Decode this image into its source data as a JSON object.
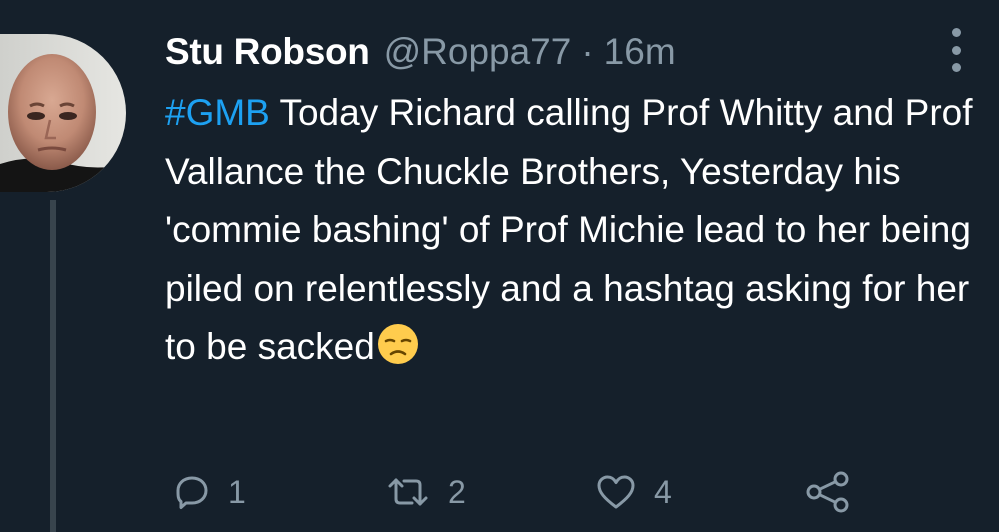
{
  "author": {
    "display_name": "Stu Robson",
    "handle": "@Roppa77",
    "separator": "·",
    "time": "16m"
  },
  "tweet": {
    "hashtag": "#GMB",
    "text": " Today Richard calling Prof Whitty and Prof Vallance the Chuckle Brothers, Yesterday his 'commie bashing' of Prof Michie lead to her being piled on relentlessly and a hashtag asking for her to be sacked",
    "emoji": "disappointed-face"
  },
  "actions": {
    "reply_count": "1",
    "retweet_count": "2",
    "like_count": "4"
  },
  "icons": {
    "reply": "reply-icon",
    "retweet": "retweet-icon",
    "like": "heart-icon",
    "share": "share-icon",
    "more": "more-options-icon"
  },
  "colors": {
    "background": "#15202b",
    "text_primary": "#ffffff",
    "text_secondary": "#8899a6",
    "hashtag": "#1da1f2",
    "thread_line": "#38444d"
  }
}
